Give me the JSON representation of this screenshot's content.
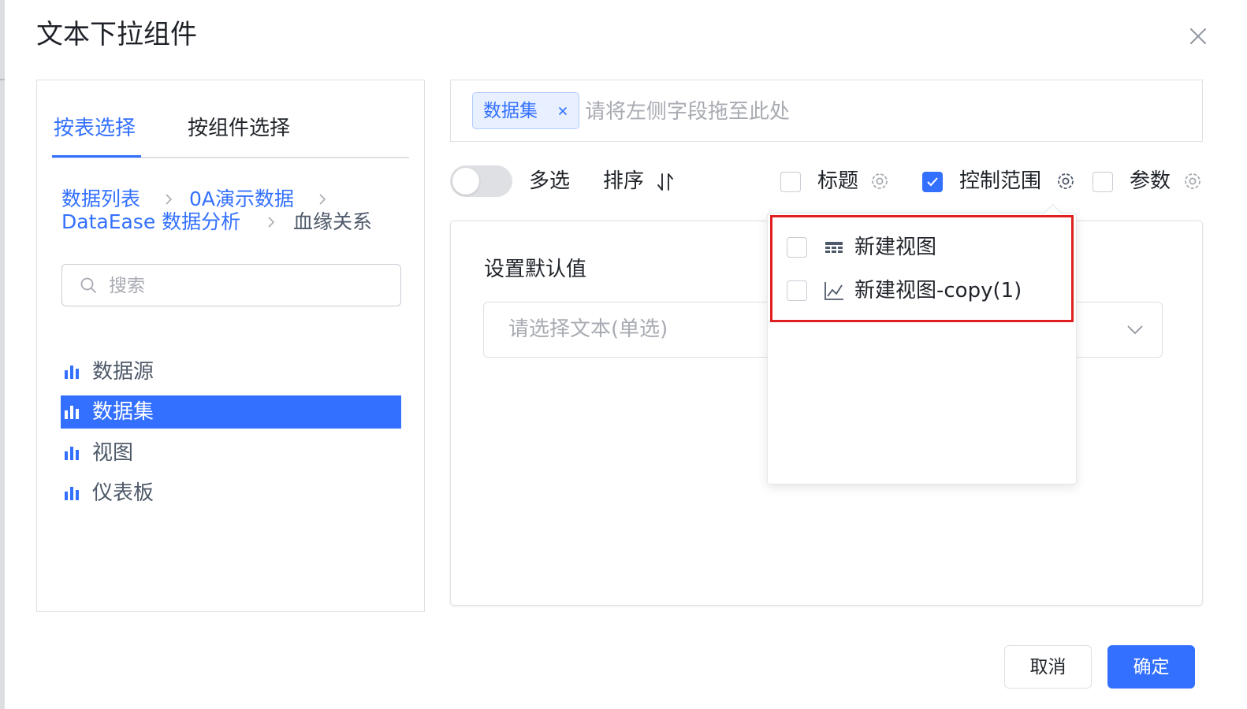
{
  "dialog": {
    "title": "文本下拉组件",
    "close_icon": "close-icon"
  },
  "left_panel": {
    "tabs": [
      {
        "label": "按表选择",
        "active": true
      },
      {
        "label": "按组件选择",
        "active": false
      }
    ],
    "breadcrumb": [
      {
        "label": "数据列表"
      },
      {
        "label": "0A演示数据"
      },
      {
        "label": "DataEase 数据分析"
      },
      {
        "label": "血缘关系"
      }
    ],
    "search": {
      "placeholder": "搜索",
      "value": ""
    },
    "tree": [
      {
        "label": "数据源",
        "icon": "bar-chart-icon",
        "selected": false
      },
      {
        "label": "数据集",
        "icon": "bar-chart-icon",
        "selected": true
      },
      {
        "label": "视图",
        "icon": "bar-chart-icon",
        "selected": false
      },
      {
        "label": "仪表板",
        "icon": "bar-chart-icon",
        "selected": false
      }
    ]
  },
  "field_drop": {
    "tag_label": "数据集",
    "hint": "请将左侧字段拖至此处"
  },
  "options": {
    "multi_select": {
      "label": "多选",
      "enabled": false
    },
    "sort": {
      "label": "排序"
    },
    "title": {
      "label": "标题",
      "checked": false
    },
    "control_range": {
      "label": "控制范围",
      "checked": true
    },
    "params": {
      "label": "参数",
      "checked": false
    }
  },
  "config": {
    "default_label": "设置默认值",
    "select_placeholder": "请选择文本(单选)"
  },
  "control_range_popover": {
    "items": [
      {
        "label": "新建视图",
        "icon": "table-icon",
        "checked": false
      },
      {
        "label": "新建视图-copy(1)",
        "icon": "line-chart-icon",
        "checked": false
      }
    ]
  },
  "footer": {
    "cancel_label": "取消",
    "confirm_label": "确定"
  },
  "colors": {
    "accent": "#3370ff",
    "highlight": "#e02020"
  }
}
